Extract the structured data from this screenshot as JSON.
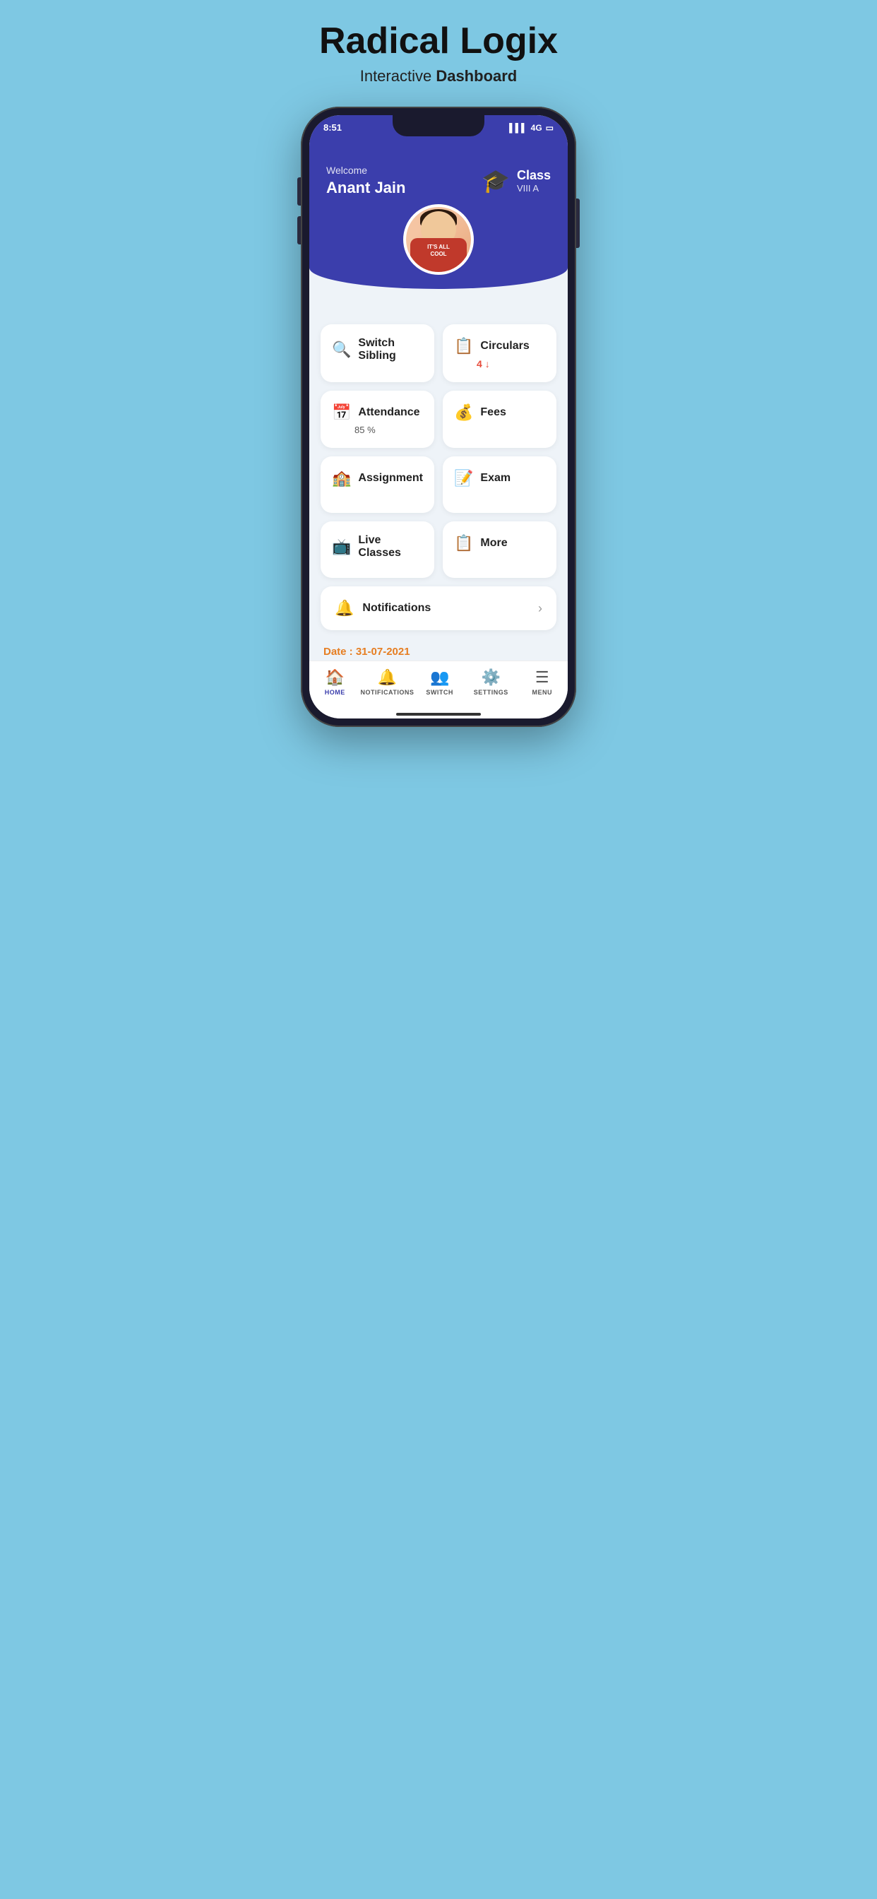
{
  "header": {
    "app_title": "Radical Logix",
    "app_subtitle_normal": "Interactive ",
    "app_subtitle_bold": "Dashboard"
  },
  "status_bar": {
    "time": "8:51",
    "signal": "4G",
    "battery": "🔋"
  },
  "welcome": {
    "label": "Welcome",
    "name": "Anant  Jain",
    "class_label": "Class",
    "class_value": "VIII A"
  },
  "cards": [
    {
      "id": "switch-sibling",
      "icon": "🔍",
      "label": "Switch Sibling",
      "sub": null
    },
    {
      "id": "circulars",
      "icon": "📋",
      "label": "Circulars",
      "sub": "4 ↓",
      "sub_color": "red"
    },
    {
      "id": "attendance",
      "icon": "📅",
      "label": "Attendance",
      "sub": "85 %"
    },
    {
      "id": "fees",
      "icon": "💰",
      "label": "Fees",
      "sub": null
    },
    {
      "id": "assignment",
      "icon": "🏫",
      "label": "Assignment",
      "sub": null
    },
    {
      "id": "exam",
      "icon": "📝",
      "label": "Exam",
      "sub": null
    },
    {
      "id": "live-classes",
      "icon": "📺",
      "label": "Live Classes",
      "sub": null
    },
    {
      "id": "more",
      "icon": "📋",
      "label": "More",
      "sub": null
    }
  ],
  "notifications": {
    "icon": "🔔",
    "label": "Notifications",
    "chevron": "›"
  },
  "date": {
    "label": "Date : 31-07-2021"
  },
  "bottom_nav": [
    {
      "id": "home",
      "icon": "🏠",
      "label": "HOME",
      "active": true
    },
    {
      "id": "notifications",
      "icon": "🔔",
      "label": "NOTIFICATIONS",
      "active": false
    },
    {
      "id": "switch",
      "icon": "👥",
      "label": "SWITCH",
      "active": false
    },
    {
      "id": "settings",
      "icon": "⚙️",
      "label": "SETTINGS",
      "active": false
    },
    {
      "id": "menu",
      "icon": "☰",
      "label": "MENU",
      "active": false
    }
  ]
}
